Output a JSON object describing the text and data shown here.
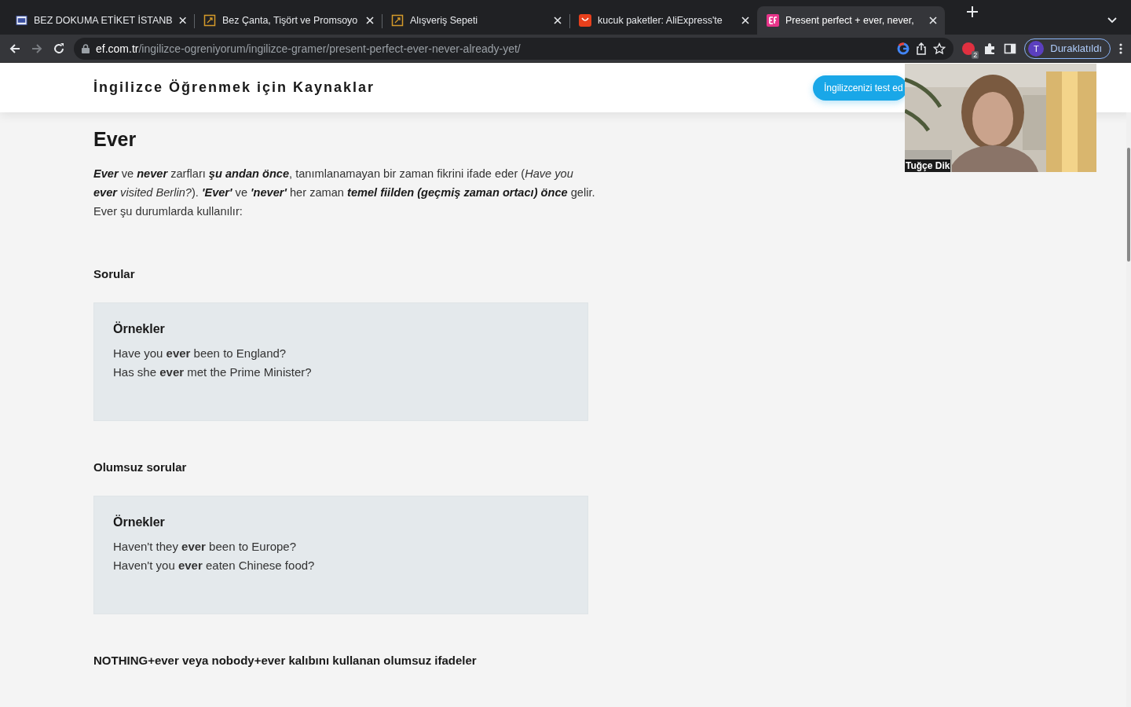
{
  "browser": {
    "tabs": [
      {
        "title": "BEZ DOKUMA ETİKET İSTANB",
        "kind": "eb",
        "selected": false
      },
      {
        "title": "Bez Çanta, Tişört ve Promsoyo",
        "kind": "frame",
        "selected": false
      },
      {
        "title": "Alışveriş Sepeti",
        "kind": "frame",
        "selected": false
      },
      {
        "title": "kucuk paketler: AliExpress'te",
        "kind": "bag",
        "selected": false
      },
      {
        "title": "Present perfect + ever, never,",
        "kind": "ef",
        "selected": true
      }
    ],
    "url_host": "ef.com.tr",
    "url_path": "/ingilizce-ogreniyorum/ingilizce-gramer/present-perfect-ever-never-already-yet/",
    "extension_badge": "2",
    "profile_initial": "T",
    "profile_label": "Duraklatıldı"
  },
  "header": {
    "title": "İngilizce Öğrenmek için Kaynaklar",
    "button": "İngilizcenizi test ed"
  },
  "video": {
    "kind": "picture",
    "name": "Tuğçe Dik"
  },
  "article": {
    "title": "Ever",
    "intro": "**Ever** ve **never** zarfları **şu andan önce**, tanımlanamayan bir zaman fikrini ifade eder (*Have you* **ever** *visited Berlin?*). **'Ever'** ve **'never'** her zaman **temel fiilden (geçmiş zaman ortacı) önce** gelir. Ever şu durumlarda kullanılır:",
    "sections": [
      {
        "heading": "Sorular",
        "examples": {
          "title": "Örnekler",
          "lines": [
            "Have you **ever** been to England?",
            "Has she **ever** met the Prime Minister?"
          ]
        }
      },
      {
        "heading": "Olumsuz sorular",
        "examples": {
          "title": "Örnekler",
          "lines": [
            "Haven't they **ever** been to Europe?",
            "Haven't you **ever** eaten Chinese food?"
          ]
        }
      },
      {
        "heading": "NOTHING+ever veya nobody+ever kalıbını kullanan olumsuz ifadeler"
      }
    ]
  }
}
